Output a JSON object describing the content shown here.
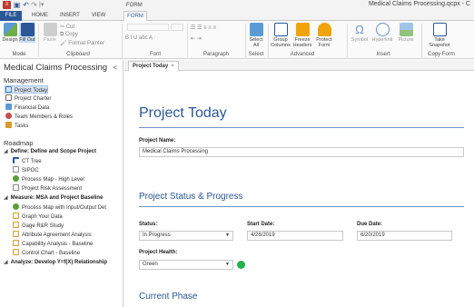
{
  "window": {
    "title": "Medical Claims Processing.qcpx - C",
    "context_tab": "FORM"
  },
  "ribbon_tabs": [
    "FILE",
    "HOME",
    "INSERT",
    "VIEW",
    "FORM"
  ],
  "ribbon": {
    "mode": {
      "label": "Mode",
      "design": "Design",
      "fill_out": "Fill Out"
    },
    "clipboard": {
      "label": "Clipboard",
      "paste": "Paste",
      "cut": "Cut",
      "copy": "Copy",
      "format_painter": "Format Painter"
    },
    "font": {
      "label": "Font",
      "controls": "B  I  U  abc  A ·"
    },
    "paragraph": {
      "label": "Paragraph"
    },
    "select": {
      "label": "Select",
      "select_all": "Select All"
    },
    "advanced": {
      "label": "Advanced",
      "group_columns": "Group Columns",
      "freeze_headers": "Freeze Headers",
      "protect_form": "Protect Form"
    },
    "insert": {
      "label": "Insert",
      "symbol": "Symbol",
      "hyperlink": "Hyperlink",
      "picture": "Picture"
    },
    "copy_form": {
      "label": "Copy Form",
      "take_snapshot": "Take Snapshot"
    }
  },
  "nav": {
    "title": "Medical Claims Processing",
    "collapse_glyph": "<",
    "management_heading": "Management",
    "management_items": [
      {
        "label": "Project Today",
        "icon": "home-icon",
        "color": "#4a7fc1"
      },
      {
        "label": "Project Charter",
        "icon": "charter-icon",
        "color": "#6d6d6d"
      },
      {
        "label": "Financial Data",
        "icon": "financial-icon",
        "color": "#5b9bd5"
      },
      {
        "label": "Team Members & Roles",
        "icon": "team-icon",
        "color": "#c0504d"
      },
      {
        "label": "Tasks",
        "icon": "tasks-icon",
        "color": "#d99b2b"
      }
    ],
    "roadmap_heading": "Roadmap",
    "phases": [
      {
        "label": "Define: Define and Scope Project",
        "items": [
          {
            "label": "CT Tree",
            "icon": "tree-icon",
            "color": "#2b5797"
          },
          {
            "label": "SIPOC",
            "icon": "sipoc-icon",
            "color": "#8a8a8a"
          },
          {
            "label": "Process Map - High Level",
            "icon": "process-map-icon",
            "color": "#5a9e3a"
          },
          {
            "label": "Project Risk Assessment",
            "icon": "risk-icon",
            "color": "#8a8a8a"
          }
        ]
      },
      {
        "label": "Measure: MSA and Project Baseline",
        "items": [
          {
            "label": "Process Map with Input/Output Det",
            "icon": "process-map-icon",
            "color": "#5a9e3a"
          },
          {
            "label": "Graph Your Data",
            "icon": "graph-icon",
            "color": "#d99b2b"
          },
          {
            "label": "Gage R&R Study",
            "icon": "gage-icon",
            "color": "#d99b2b"
          },
          {
            "label": "Attribute Agreement Analysis",
            "icon": "attribute-icon",
            "color": "#d99b2b"
          },
          {
            "label": "Capability Analysis - Baseline",
            "icon": "capability-icon",
            "color": "#d99b2b"
          },
          {
            "label": "Control Chart - Baseline",
            "icon": "control-chart-icon",
            "color": "#d99b2b"
          }
        ]
      },
      {
        "label": "Analyze: Develop Y=f(X) Relationship",
        "items": []
      }
    ]
  },
  "doc_tab": {
    "label": "Project Today",
    "close": "×"
  },
  "form": {
    "title": "Project Today",
    "project_name_label": "Project Name:",
    "project_name_value": "Medical Claims Processing",
    "status_section": "Project Status & Progress",
    "status_label": "Status:",
    "status_value": "In Progress",
    "start_label": "Start Date:",
    "start_value": "4/26/2019",
    "due_label": "Due Date:",
    "due_value": "6/20/2019",
    "health_label": "Project Health:",
    "health_value": "Green",
    "health_color": "#22b14c",
    "phase_section": "Current Phase"
  }
}
